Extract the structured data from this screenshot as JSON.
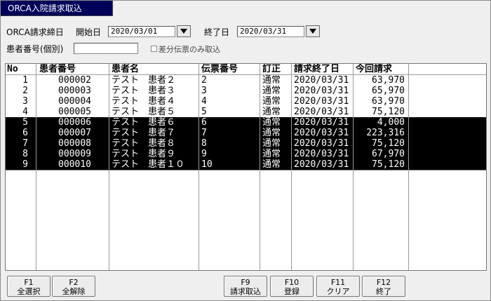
{
  "window": {
    "title": "ORCA入院請求取込"
  },
  "filters": {
    "billing_date_label": "ORCA請求締日",
    "start_label": "開始日",
    "start_value": "2020/03/01",
    "end_label": "終了日",
    "end_value": "2020/03/31",
    "patient_no_label": "患者番号(個別)",
    "patient_no_value": "",
    "diff_only_label": "差分伝票のみ取込"
  },
  "table": {
    "headers": [
      "No",
      "患者番号",
      "患者名",
      "伝票番号",
      "訂正",
      "請求終了日",
      "今回請求"
    ],
    "rows": [
      {
        "no": "1",
        "patient_id": "000002",
        "name": "テスト　患者２",
        "slip": "2",
        "type": "通常",
        "end_date": "2020/03/31",
        "amount": "63,970",
        "selected": false
      },
      {
        "no": "2",
        "patient_id": "000003",
        "name": "テスト　患者３",
        "slip": "3",
        "type": "通常",
        "end_date": "2020/03/31",
        "amount": "65,970",
        "selected": false
      },
      {
        "no": "3",
        "patient_id": "000004",
        "name": "テスト　患者４",
        "slip": "4",
        "type": "通常",
        "end_date": "2020/03/31",
        "amount": "63,970",
        "selected": false
      },
      {
        "no": "4",
        "patient_id": "000005",
        "name": "テスト　患者５",
        "slip": "5",
        "type": "通常",
        "end_date": "2020/03/31",
        "amount": "75,120",
        "selected": false
      },
      {
        "no": "5",
        "patient_id": "000006",
        "name": "テスト　患者６",
        "slip": "6",
        "type": "通常",
        "end_date": "2020/03/31",
        "amount": "4,000",
        "selected": true
      },
      {
        "no": "6",
        "patient_id": "000007",
        "name": "テスト　患者７",
        "slip": "7",
        "type": "通常",
        "end_date": "2020/03/31",
        "amount": "223,316",
        "selected": true
      },
      {
        "no": "7",
        "patient_id": "000008",
        "name": "テスト　患者８",
        "slip": "8",
        "type": "通常",
        "end_date": "2020/03/31",
        "amount": "75,120",
        "selected": true
      },
      {
        "no": "8",
        "patient_id": "000009",
        "name": "テスト　患者９",
        "slip": "9",
        "type": "通常",
        "end_date": "2020/03/31",
        "amount": "67,970",
        "selected": true
      },
      {
        "no": "9",
        "patient_id": "000010",
        "name": "テスト　患者１０",
        "slip": "10",
        "type": "通常",
        "end_date": "2020/03/31",
        "amount": "75,120",
        "selected": true
      }
    ]
  },
  "fkeys": {
    "f1": {
      "key": "F1",
      "label": "全選択"
    },
    "f2": {
      "key": "F2",
      "label": "全解除"
    },
    "f9": {
      "key": "F9",
      "label": "請求取込"
    },
    "f10": {
      "key": "F10",
      "label": "登録"
    },
    "f11": {
      "key": "F11",
      "label": "クリア"
    },
    "f12": {
      "key": "F12",
      "label": "終了"
    }
  },
  "colors": {
    "title_bg": "#00005a",
    "selected_row_bg": "#000000"
  }
}
